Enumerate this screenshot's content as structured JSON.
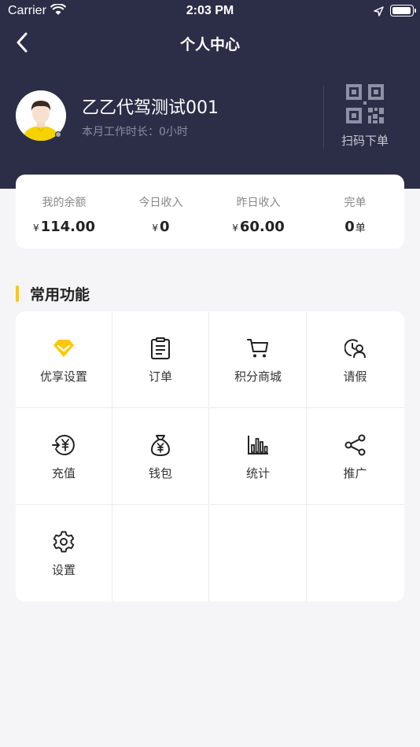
{
  "status_bar": {
    "carrier": "Carrier",
    "time": "2:03 PM"
  },
  "nav": {
    "title": "个人中心"
  },
  "profile": {
    "name": "乙乙代驾测试001",
    "work_hours": "本月工作时长：0小时",
    "scan_label": "扫码下单"
  },
  "stats": [
    {
      "label": "我的余额",
      "prefix": "¥",
      "value": "114.00",
      "suffix": ""
    },
    {
      "label": "今日收入",
      "prefix": "¥",
      "value": "0",
      "suffix": ""
    },
    {
      "label": "昨日收入",
      "prefix": "¥",
      "value": "60.00",
      "suffix": ""
    },
    {
      "label": "完单",
      "prefix": "",
      "value": "0",
      "suffix": "单"
    }
  ],
  "section": {
    "title": "常用功能"
  },
  "functions": [
    {
      "label": "优享设置",
      "icon": "diamond-icon"
    },
    {
      "label": "订单",
      "icon": "clipboard-icon"
    },
    {
      "label": "积分商城",
      "icon": "cart-icon"
    },
    {
      "label": "请假",
      "icon": "leave-icon"
    },
    {
      "label": "充值",
      "icon": "recharge-icon"
    },
    {
      "label": "钱包",
      "icon": "moneybag-icon"
    },
    {
      "label": "统计",
      "icon": "bar-chart-icon"
    },
    {
      "label": "推广",
      "icon": "share-icon"
    },
    {
      "label": "设置",
      "icon": "gear-icon"
    }
  ],
  "colors": {
    "header_bg": "#2c2e48",
    "accent": "#ffc800",
    "page_bg": "#f5f5f7"
  }
}
